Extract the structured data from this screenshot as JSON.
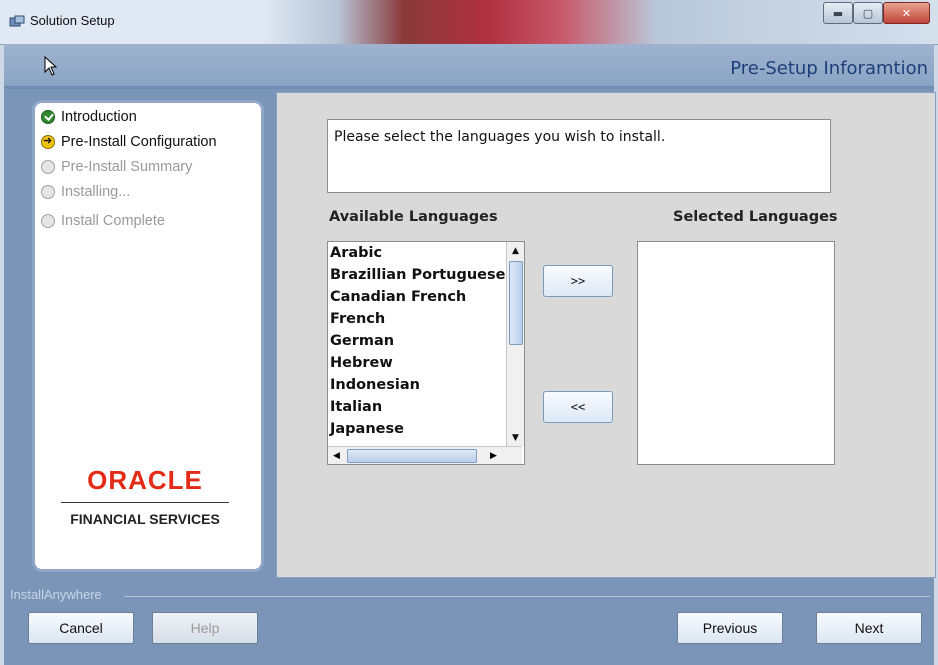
{
  "window": {
    "title": "Solution Setup",
    "controls": [
      "minimize",
      "maximize",
      "close"
    ]
  },
  "header": {
    "title": "Pre-Setup Inforamtion"
  },
  "steps": [
    {
      "label": "Introduction",
      "state": "done"
    },
    {
      "label": "Pre-Install Configuration",
      "state": "current"
    },
    {
      "label": "Pre-Install Summary",
      "state": "pending"
    },
    {
      "label": "Installing...",
      "state": "pending"
    },
    {
      "label": "Install Complete",
      "state": "pending"
    }
  ],
  "branding": {
    "logo": "ORACLE",
    "tagline": "FINANCIAL SERVICES"
  },
  "main": {
    "instruction": "Please select the languages you wish to install.",
    "available_label": "Available Languages",
    "selected_label": "Selected Languages",
    "available_languages": [
      "Arabic",
      "Brazillian Portuguese",
      "Canadian French",
      "French",
      "German",
      "Hebrew",
      "Indonesian",
      "Italian",
      "Japanese"
    ],
    "selected_languages": [],
    "add_button": ">>",
    "remove_button": "<<"
  },
  "footer": {
    "brand": "InstallAnywhere",
    "cancel": "Cancel",
    "help": "Help",
    "previous": "Previous",
    "next": "Next"
  },
  "colors": {
    "header_text": "#1d3f7a",
    "oracle_red": "#e32b17",
    "frame_blue": "#7a95b8"
  }
}
